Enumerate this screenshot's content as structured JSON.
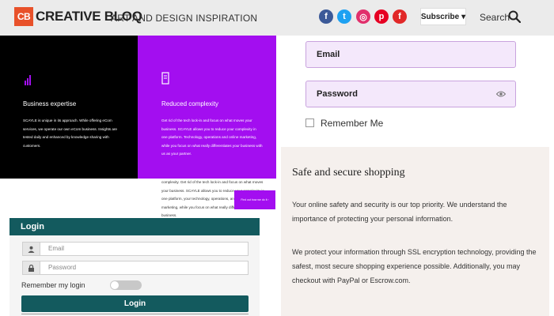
{
  "header": {
    "logo_mark": "CB",
    "logo_text": "CREATIVE BLOQ",
    "tagline": "ART AND DESIGN INSPIRATION",
    "social": [
      {
        "name": "facebook",
        "glyph": "f",
        "color": "#3b5998"
      },
      {
        "name": "twitter",
        "glyph": "t",
        "color": "#1da1f2"
      },
      {
        "name": "instagram",
        "glyph": "◎",
        "color": "#e1306c"
      },
      {
        "name": "pinterest",
        "glyph": "p",
        "color": "#e60023"
      },
      {
        "name": "flipboard",
        "glyph": "f",
        "color": "#e12828"
      }
    ],
    "subscribe_label": "Subscribe",
    "subscribe_caret": "▾",
    "search_label": "Search"
  },
  "features": {
    "business": {
      "title": "Business expertise",
      "body": "SCAYLE is unique in its approach. While offering eCom services, we operate our own eCom business. Insights are tested daily and enhanced by knowledge sharing with customers."
    },
    "complexity": {
      "title": "Reduced complexity",
      "body": "Get rid of the tech lock-in and focus on what moves your business. SCAYLE allows you to reduce your complexity in one platform. Technology, operations and online marketing, while you focus on what really differentiates your business with us as your partner.",
      "body_ext": "complexity. Get rid of the tech lock-in and focus on what moves your business. SCAYLE allows you to reduce your complexity in one platform, your technology, operations, and online marketing, while you focus on what really differentiates your business.",
      "button": "Find out how we do it ›"
    }
  },
  "login": {
    "title": "Login",
    "email_placeholder": "Email",
    "password_placeholder": "Password",
    "remember_label": "Remember my login",
    "submit_label": "Login"
  },
  "account_form": {
    "email_label": "Email",
    "password_label": "Password",
    "remember_label": "Remember Me"
  },
  "safe_shopping": {
    "title": "Safe and secure shopping",
    "paragraph1": "Your online safety and security is our top priority. We understand the importance of protecting your personal information.",
    "paragraph2": "We protect your information through SSL encryption technology, providing the safest, most secure shopping experience possible. Additionally, you may checkout with PayPal or Escrow.com."
  }
}
